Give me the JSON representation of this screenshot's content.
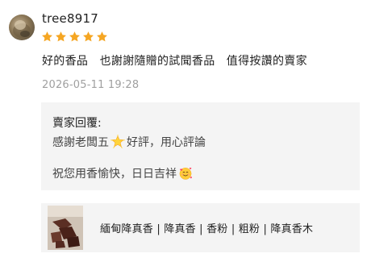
{
  "review": {
    "username": "tree8917",
    "rating": 5,
    "rating_max": 5,
    "text": "好的香品　也謝謝隨贈的試聞香品　值得按讚的賣家",
    "timestamp": "2026-05-11 19:28"
  },
  "seller_reply": {
    "title": "賣家回覆:",
    "line1_before_emoji": "感謝老闆五",
    "line1_emoji": "glowing-star-emoji",
    "line1_after_emoji": "好評，用心評論",
    "line2_text": "祝您用香愉快，日日吉祥",
    "line2_emoji": "smiling-face-with-hearts-emoji"
  },
  "product": {
    "title": "緬甸降真香 | 降真香 | 香粉 | 粗粉 | 降真香木"
  },
  "colors": {
    "star": "#f5a623",
    "timestamp": "#a0a0a0",
    "panel_bg": "#f4f4f4"
  }
}
